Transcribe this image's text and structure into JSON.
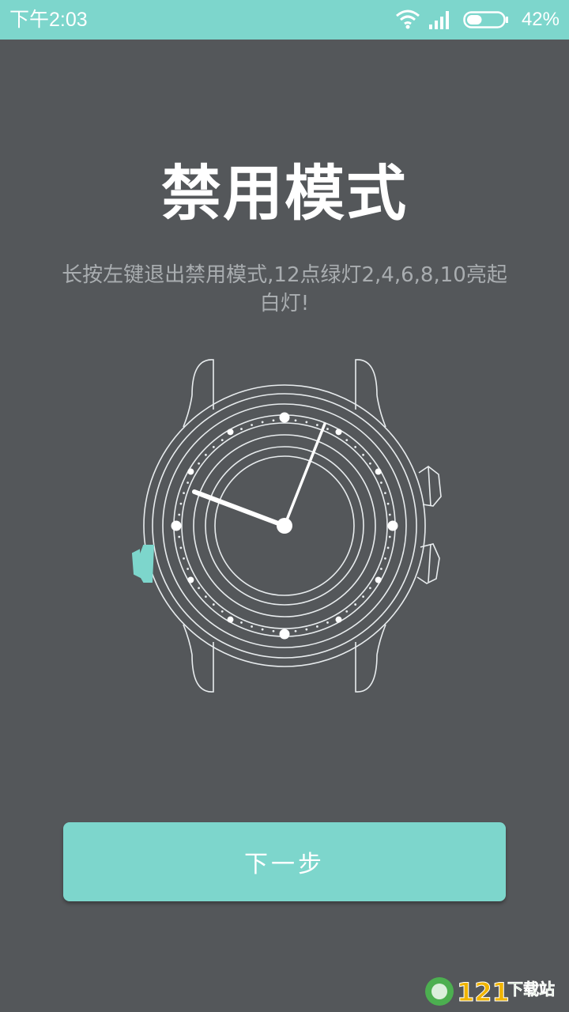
{
  "status_bar": {
    "time": "下午2:03",
    "battery_percent_label": "42%",
    "battery_level": 0.42,
    "icons": [
      "wifi-icon",
      "signal-icon",
      "battery-icon"
    ]
  },
  "title": "禁用模式",
  "subtitle": "长按左键退出禁用模式,12点绿灯2,4,6,8,10亮起白灯!",
  "watch_illustration": {
    "icon": "watch-illustration",
    "accent_color": "#7dd6cc"
  },
  "next_button": {
    "label": "下一步"
  },
  "watermark": {
    "text": "121下载站"
  },
  "colors": {
    "background": "#54575a",
    "accent": "#7dd6cc",
    "subtitle": "#a9adb0"
  }
}
